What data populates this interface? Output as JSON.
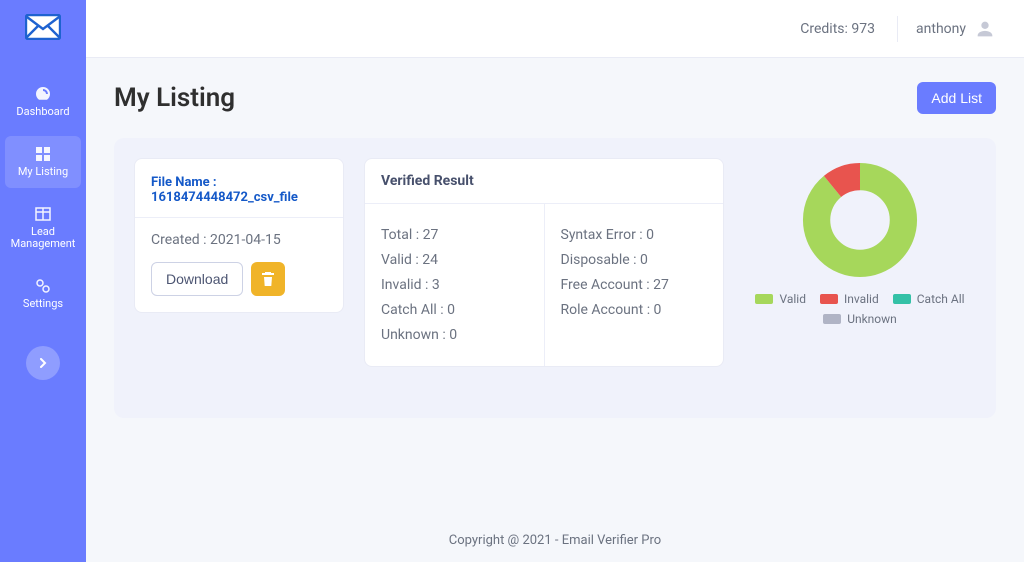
{
  "header": {
    "credits_label": "Credits:",
    "credits_value": "973",
    "username": "anthony"
  },
  "sidebar": {
    "items": [
      {
        "label": "Dashboard"
      },
      {
        "label": "My Listing"
      },
      {
        "label": "Lead Management"
      },
      {
        "label": "Settings"
      }
    ]
  },
  "page": {
    "title": "My Listing",
    "add_list": "Add List"
  },
  "file_card": {
    "file_name_label": "File Name :",
    "file_name": "1618474448472_csv_file",
    "created_label": "Created :",
    "created_value": "2021-04-15",
    "download": "Download"
  },
  "verify": {
    "heading": "Verified Result",
    "left": {
      "total": "Total : 27",
      "valid": "Valid : 24",
      "invalid": "Invalid : 3",
      "catchall": "Catch All : 0",
      "unknown": "Unknown : 0"
    },
    "right": {
      "syntax": "Syntax Error : 0",
      "disposable": "Disposable : 0",
      "freeacc": "Free Account : 27",
      "roleacc": "Role Account : 0"
    }
  },
  "legend": {
    "valid": "Valid",
    "invalid": "Invalid",
    "catchall": "Catch All",
    "unknown": "Unknown"
  },
  "colors": {
    "valid": "#a6d75b",
    "invalid": "#e8544e",
    "catchall": "#34c1a7",
    "unknown": "#b0b4c5"
  },
  "chart_data": {
    "type": "pie",
    "title": "",
    "series": [
      {
        "name": "Valid",
        "value": 24,
        "color": "#a6d75b"
      },
      {
        "name": "Invalid",
        "value": 3,
        "color": "#e8544e"
      },
      {
        "name": "Catch All",
        "value": 0,
        "color": "#34c1a7"
      },
      {
        "name": "Unknown",
        "value": 0,
        "color": "#b0b4c5"
      }
    ]
  },
  "footer": "Copyright @ 2021 - Email Verifier Pro"
}
